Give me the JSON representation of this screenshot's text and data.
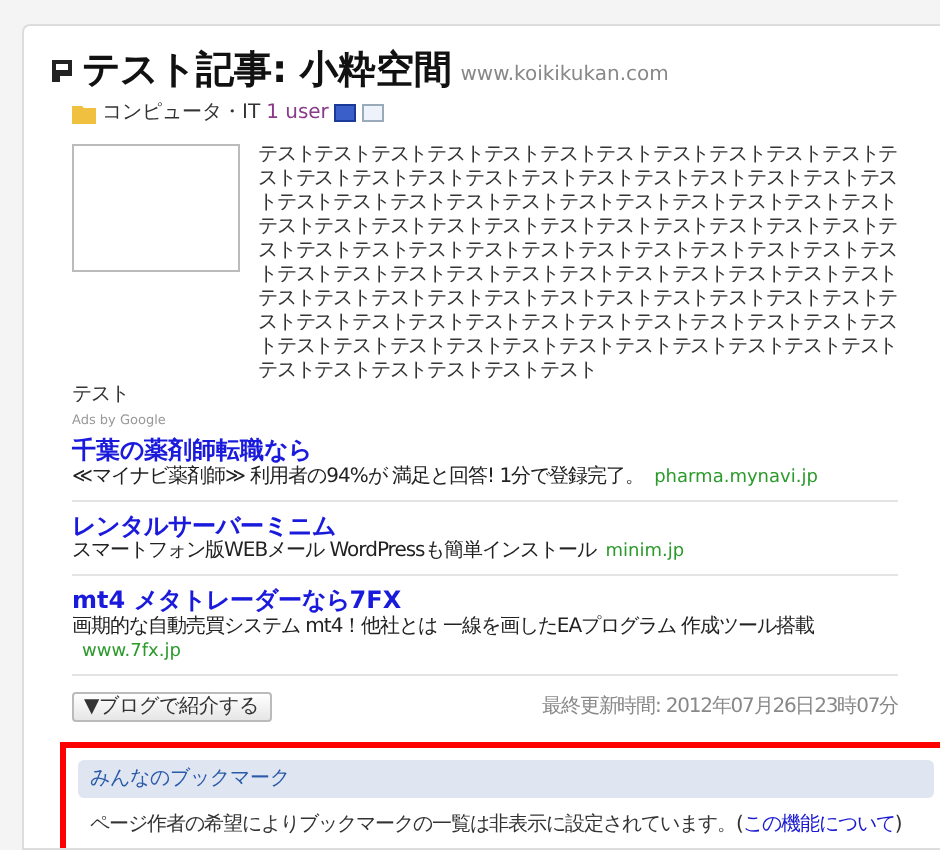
{
  "entry": {
    "title": "テスト記事: 小粋空間",
    "domain": "www.koikikukan.com",
    "category": "コンピュータ・IT",
    "users": "1 user",
    "body": "テストテストテストテストテストテストテストテストテストテストテストテストテストテストテストテストテストテストテストテストテストテストテストテストテストテストテストテストテストテストテストテストテストテストテストテストテストテストテストテストテストテストテストテストテストテストテストテストテストテストテストテストテストテストテストテストテストテストテストテストテストテストテストテストテストテストテストテストテストテストテストテストテストテストテストテストテストテストテストテストテストテストテストテストテストテストテストテストテストテストテストテストテストテストテストテストテストテストテストテストテストテストテストテストテストテストテストテスト",
    "tail": "テスト"
  },
  "ads": {
    "label": "Ads by Google",
    "items": [
      {
        "title": "千葉の薬剤師転職なら",
        "text": "≪マイナビ薬剤師≫ 利用者の94%が 満足と回答! 1分で登録完了。",
        "url": "pharma.mynavi.jp"
      },
      {
        "title": "レンタルサーバーミニム",
        "text": "スマートフォン版WEBメール WordPressも簡単インストール",
        "url": "minim.jp"
      },
      {
        "title": "mt4 メタトレーダーなら7FX",
        "text": "画期的な自動売買システム mt4！他社とは 一線を画したEAプログラム 作成ツール搭載",
        "url": "www.7fx.jp"
      }
    ]
  },
  "share_button": "▼ブログで紹介する",
  "updated": "最終更新時間: 2012年07月26日23時07分",
  "bookmarks": {
    "heading": "みんなのブックマーク",
    "message": "ページ作者の希望によりブックマークの一覧は非表示に設定されています。(",
    "link": "この機能について",
    "close": ")"
  }
}
